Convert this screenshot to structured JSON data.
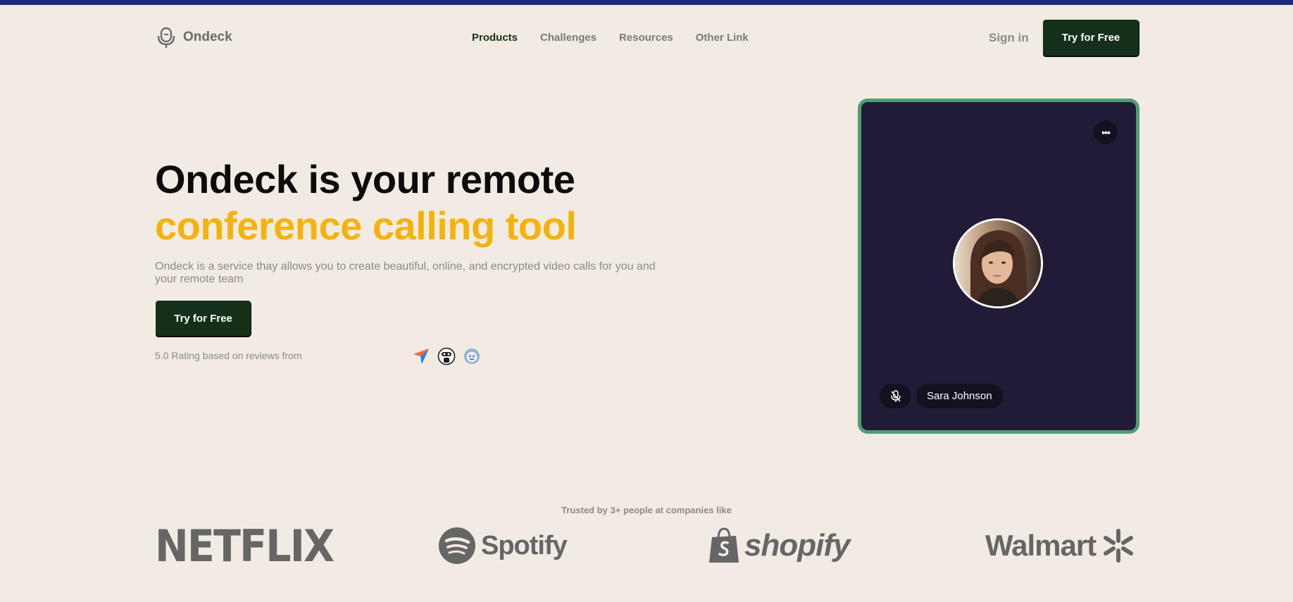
{
  "colors": {
    "background": "#f1ebe3",
    "top_strip": "#1d2a7a",
    "primary_button": "#14301a",
    "accent_yellow": "#f5b20a",
    "card_bg": "#221b38",
    "card_border": "#4f9d73",
    "muted_text": "#8a8a8a"
  },
  "nav": {
    "logo_text": "Ondeck",
    "logo_icon": "microphone-icon",
    "links": [
      {
        "label": "Products",
        "active": true
      },
      {
        "label": "Challenges",
        "active": false
      },
      {
        "label": "Resources",
        "active": false
      },
      {
        "label": "Other Link",
        "active": false
      }
    ],
    "signin_label": "Sign in",
    "cta_label": "Try for Free"
  },
  "hero": {
    "title_line1": "Ondeck is your remote",
    "title_line2": "conference calling tool",
    "subtitle": "Ondeck is a service thay allows you to create beautiful, online, and encrypted video calls for you and your remote team",
    "cta_label": "Try for Free",
    "rating_text": "5.0 Rating based on reviews from",
    "review_icons": [
      "paper-plane-icon",
      "robot-face-icon",
      "smiley-face-icon"
    ]
  },
  "video_card": {
    "more_icon": "more-dots-icon",
    "more_label": "•••",
    "mic_icon": "mic-off-icon",
    "participant_name": "Sara Johnson"
  },
  "trusted": {
    "text": "Trusted by 3+ people at companies like",
    "brands": [
      "NETFLIX",
      "Spotify",
      "shopify",
      "Walmart"
    ]
  }
}
